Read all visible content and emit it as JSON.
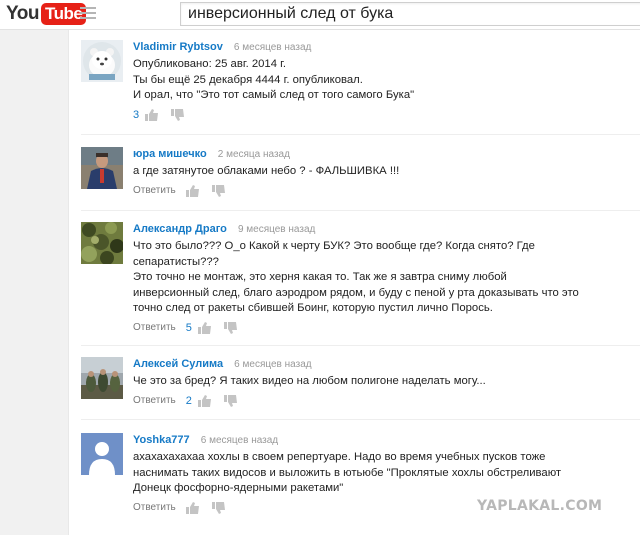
{
  "header": {
    "logo_you": "You",
    "logo_tube": "Tube",
    "search_value": "инверсионный след от бука",
    "guide_icon": "hamburger-menu-icon"
  },
  "comments": [
    {
      "author": "Vladimir Rybtsov",
      "time": "6 месяцев назад",
      "lines": [
        "Опубликовано: 25 авг. 2014 г.",
        "Ты бы ещё 25 декабря 4444 г. опубликовал.",
        "И орал, что \"Это тот самый след от того самого Бука\""
      ],
      "reply": "",
      "likes": "3"
    },
    {
      "author": "юра мишечко",
      "time": "2 месяца назад",
      "lines": [
        "а где затянутое облаками небо ? - ФАЛЬШИВКА !!!"
      ],
      "reply": "Ответить",
      "likes": ""
    },
    {
      "author": "Александр Драго",
      "time": "9 месяцев назад",
      "lines": [
        "Что это было??? О_о  Какой к черту БУК? Это вообще где? Когда снято? Где",
        "сепаратисты???",
        "Это точно не монтаж, это херня какая то. Так же я завтра сниму любой",
        "инверсионный след, благо аэродром рядом, и буду с пеной у рта доказывать что это",
        "точно след от ракеты сбившей Боинг, которую пустил лично Порось."
      ],
      "reply": "Ответить",
      "likes": "5"
    },
    {
      "author": "Алексей Сулима",
      "time": "6 месяцев назад",
      "lines": [
        "Че это за бред? Я таких видео на любом полигоне наделать могу..."
      ],
      "reply": "Ответить",
      "likes": "2"
    },
    {
      "author": "Yoshka777",
      "time": "6 месяцев назад",
      "lines": [
        "ахахахахахаа хохлы в своем репертуаре. Надо во время учебных пусков тоже",
        "наснимать таких видосов и выложить в ютьюбе \"Проклятые хохлы обстреливают",
        "Донецк фосфорно-ядерными ракетами\""
      ],
      "reply": "Ответить",
      "likes": ""
    }
  ],
  "watermark": "YAPLAKAL.COM",
  "colors": {
    "brand_red": "#e62117",
    "author_blue": "#167ac6",
    "meta_grey": "#999999"
  }
}
